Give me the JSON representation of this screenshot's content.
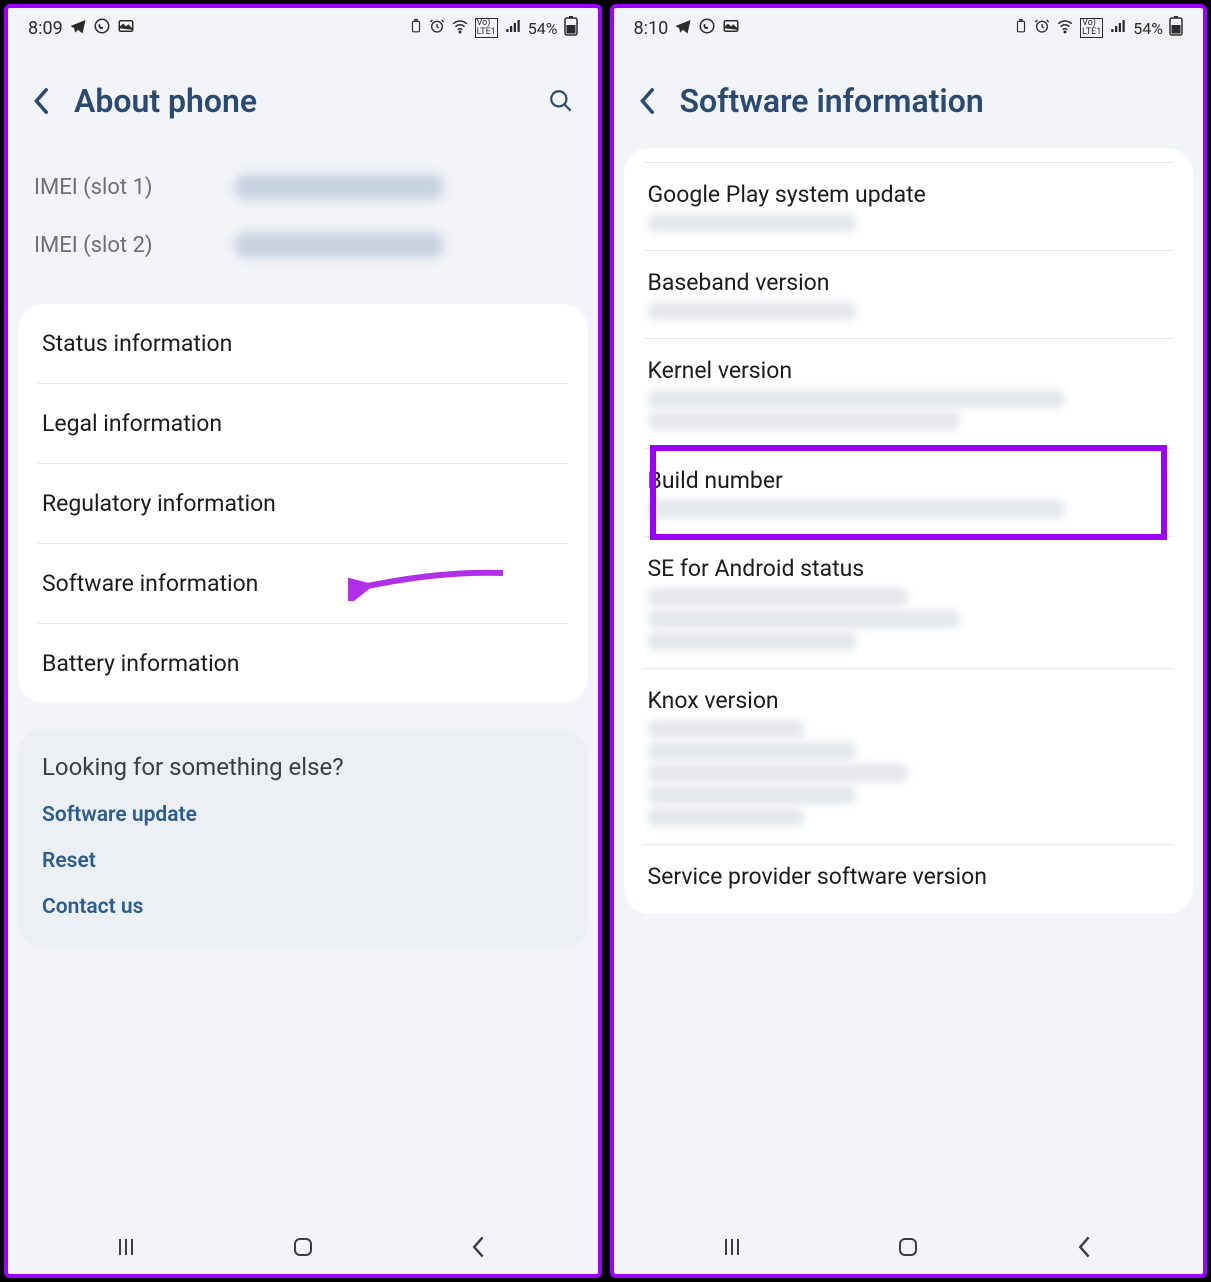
{
  "left": {
    "status": {
      "time": "8:09",
      "battery": "54%"
    },
    "title": "About phone",
    "imei1_label": "IMEI (slot 1)",
    "imei2_label": "IMEI (slot 2)",
    "items": {
      "status_info": "Status information",
      "legal_info": "Legal information",
      "regulatory_info": "Regulatory information",
      "software_info": "Software information",
      "battery_info": "Battery information"
    },
    "footer": {
      "heading": "Looking for something else?",
      "software_update": "Software update",
      "reset": "Reset",
      "contact_us": "Contact us"
    }
  },
  "right": {
    "status": {
      "time": "8:10",
      "battery": "54%"
    },
    "title": "Software information",
    "items": {
      "gplay": "Google Play system update",
      "baseband": "Baseband version",
      "kernel": "Kernel version",
      "build": "Build number",
      "se": "SE for Android status",
      "knox": "Knox version",
      "spsw": "Service provider software version"
    }
  },
  "status_icons": {
    "telegram": "telegram-icon",
    "whatsapp": "whatsapp-icon",
    "gallery": "gallery-icon",
    "lowbat": "battery-low-icon",
    "alarm": "alarm-icon",
    "wifi": "wifi-icon",
    "volte": "volte-icon",
    "signal": "signal-icon",
    "battery": "battery-icon"
  }
}
